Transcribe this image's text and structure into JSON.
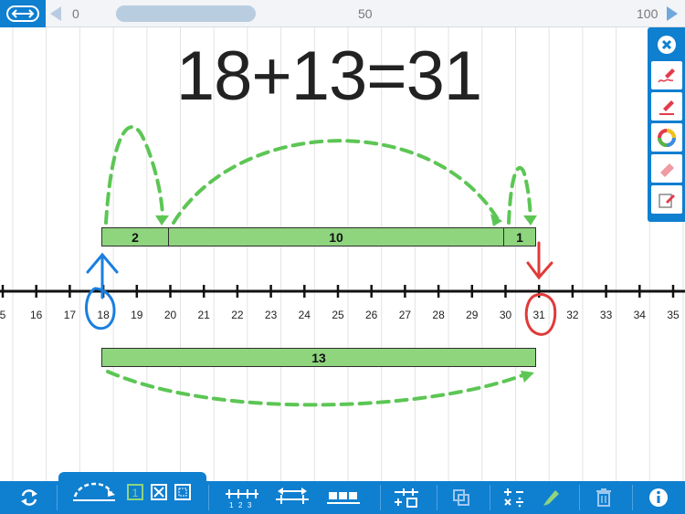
{
  "top_bar": {
    "range_min": "0",
    "range_mid": "50",
    "range_max": "100"
  },
  "equation": "18+13=31",
  "number_line": {
    "labels": [
      "5",
      "16",
      "17",
      "18",
      "19",
      "20",
      "21",
      "22",
      "23",
      "24",
      "25",
      "26",
      "27",
      "28",
      "29",
      "30",
      "31",
      "32",
      "33",
      "34",
      "35"
    ]
  },
  "bars": {
    "top_segments": [
      "2",
      "10",
      "1"
    ],
    "bottom_total": "13"
  },
  "colors": {
    "accent": "#0f7fd0",
    "bar_fill": "#8ed57e",
    "jump_arrow": "#5cc654",
    "start_marker": "#1a7fe0",
    "end_marker": "#e03a3a"
  },
  "tool_palette": [
    "close-icon",
    "freehand-pen-icon",
    "line-pen-icon",
    "color-wheel-icon",
    "eraser-icon",
    "note-icon"
  ],
  "toolbar_icons": [
    "refresh-icon",
    "jump-arc-icon",
    "number-box-icon",
    "hidden-box-icon",
    "blank-box-icon",
    "numbered-ticks-icon",
    "range-stretch-icon",
    "block-ticks-icon",
    "add-bar-icon",
    "layers-icon",
    "operations-icon",
    "highlighter-icon",
    "trash-icon",
    "info-icon"
  ],
  "toolbar": {
    "box_number": "1"
  }
}
